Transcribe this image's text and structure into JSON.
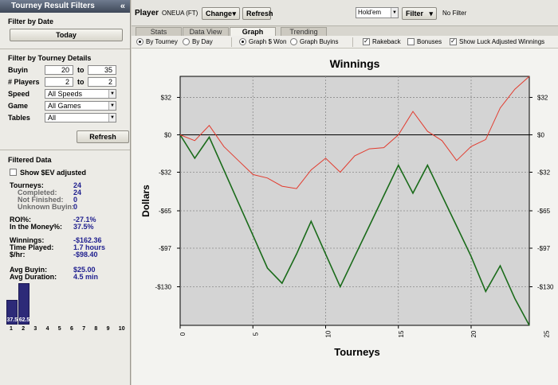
{
  "sidebar": {
    "title": "Tourney Result Filters",
    "collapse_glyph": "«",
    "filter_by_date": "Filter by Date",
    "today_label": "Today",
    "filter_by_details": "Filter by Tourney Details",
    "buyin_label": "Buyin",
    "buyin_from": "20",
    "buyin_to": "35",
    "players_label": "# Players",
    "players_from": "2",
    "players_to": "2",
    "to_label": "to",
    "speed_label": "Speed",
    "speed_value": "All Speeds",
    "game_label": "Game",
    "game_value": "All Games",
    "tables_label": "Tables",
    "tables_value": "All",
    "refresh_label": "Refresh",
    "filtered_data": "Filtered Data",
    "show_sev_label": "Show $EV adjusted",
    "show_sev_checked": false,
    "stats": {
      "tourneys_label": "Tourneys:",
      "tourneys": "24",
      "completed_label": "Completed:",
      "completed": "24",
      "not_finished_label": "Not Finished:",
      "not_finished": "0",
      "unknown_buyin_label": "Unknown Buyin:",
      "unknown_buyin": "0",
      "roi_label": "ROI%:",
      "roi": "-27.1%",
      "itm_label": "In the Money%:",
      "itm": "37.5%",
      "winnings_label": "Winnings:",
      "winnings": "-$162.36",
      "time_label": "Time Played:",
      "time": "1.7 hours",
      "hr_label": "$/hr:",
      "hr": "-$98.40",
      "avg_buyin_label": "Avg Buyin:",
      "avg_buyin": "$25.00",
      "avg_duration_label": "Avg Duration:",
      "avg_duration": "4.5 min"
    },
    "histogram": {
      "bars": [
        {
          "value": 37.5,
          "label": "37.5"
        },
        {
          "value": 62.5,
          "label": "62.5"
        }
      ],
      "ticks": [
        "1",
        "2",
        "3",
        "4",
        "5",
        "6",
        "7",
        "8",
        "9",
        "10"
      ]
    }
  },
  "toolbar": {
    "player_label": "Player",
    "player_name": "ONEUA (FT)",
    "change_label": "Change",
    "change_arrow": "▾",
    "refresh_label": "Refresh",
    "game_select": "Hold'em",
    "filter_label": "Filter",
    "filter_arrow": "▾",
    "no_filter": "No Filter"
  },
  "tabs": [
    {
      "label": "Stats",
      "active": false
    },
    {
      "label": "Data View",
      "active": false
    },
    {
      "label": "Graph",
      "active": true
    },
    {
      "label": "Trending",
      "active": false
    }
  ],
  "options": {
    "by_tourney": "By Tourney",
    "by_day": "By Day",
    "graph_won": "Graph $ Won",
    "graph_buyins": "Graph Buyins",
    "rakeback": "Rakeback",
    "bonuses": "Bonuses",
    "luck_adjusted": "Show Luck Adjusted Winnings",
    "rakeback_checked": true,
    "bonuses_checked": false,
    "luck_checked": true
  },
  "chart_data": {
    "type": "line",
    "title": "Winnings",
    "xlabel": "Tourneys",
    "ylabel": "Dollars",
    "xlim": [
      0,
      24
    ],
    "ylim": [
      -163,
      50
    ],
    "x_ticks": [
      0,
      5,
      10,
      15,
      20,
      25
    ],
    "y_ticks": [
      32,
      0,
      -32,
      -65,
      -97,
      -130
    ],
    "y_tick_labels": [
      "$32",
      "$0",
      "-$32",
      "-$65",
      "-$97",
      "-$130"
    ],
    "grid": true,
    "series": [
      {
        "color": "#1a6b1a",
        "x": [
          0,
          1,
          2,
          3,
          4,
          5,
          6,
          7,
          8,
          9,
          10,
          11,
          12,
          13,
          14,
          15,
          16,
          17,
          18,
          19,
          20,
          21,
          22,
          23,
          24
        ],
        "values": [
          0,
          -20,
          -2,
          -30,
          -58,
          -86,
          -114,
          -127,
          -102,
          -74,
          -102,
          -130,
          -104,
          -78,
          -52,
          -26,
          -50,
          -26,
          -52,
          -78,
          -104,
          -134,
          -112,
          -140,
          -163
        ]
      },
      {
        "color": "#e23b2e",
        "x": [
          0,
          1,
          2,
          3,
          4,
          5,
          6,
          7,
          8,
          9,
          10,
          11,
          12,
          13,
          14,
          15,
          16,
          17,
          18,
          19,
          20,
          21,
          22,
          23,
          24
        ],
        "values": [
          0,
          -5,
          8,
          -10,
          -22,
          -34,
          -37,
          -44,
          -46,
          -30,
          -20,
          -32,
          -18,
          -12,
          -11,
          0,
          20,
          3,
          -5,
          -22,
          -10,
          -4,
          23,
          39,
          50
        ]
      }
    ]
  }
}
